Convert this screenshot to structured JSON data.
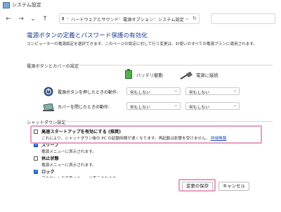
{
  "window": {
    "title": "システム設定"
  },
  "nav": {
    "breadcrumbs": [
      "ハードウェアとサウンド",
      "電源オプション",
      "システム設定"
    ]
  },
  "page": {
    "heading": "電源ボタンの定義とパスワード保護の有効化",
    "description": "コンピューターの電源設定を選択できます。このページの設定に対して行う変更は、お使いのすべての電源プランに適用されます。",
    "section_power": "電源ボタンとカバーの設定",
    "col_battery": "バッテリ駆動",
    "col_plugged": "電源に接続",
    "rows": [
      {
        "label": "電源ボタンを押したときの動作:",
        "battery": "何もしない",
        "plugged": "何もしない"
      },
      {
        "label": "カバーを閉じたときの動作:",
        "battery": "何もしない",
        "plugged": "何もしない"
      }
    ],
    "section_shutdown": "シャットダウン設定",
    "options": [
      {
        "title": "高速スタートアップを有効にする (推奨)",
        "desc": "これにより、シャットダウン後の PC の起動時間が速くなります。再起動は影響を受けません。",
        "link": "詳細情報",
        "checked": false
      },
      {
        "title": "スリープ",
        "desc": "電源メニューに表示されます。",
        "checked": true
      },
      {
        "title": "休止状態",
        "desc": "電源メニューに表示されます。",
        "checked": false
      },
      {
        "title": "ロック",
        "desc": "アカウントの画像メニューに表示されます。",
        "checked": true
      }
    ]
  },
  "footer": {
    "save": "変更の保存",
    "cancel": "キャンセル"
  },
  "colors": {
    "heading": "#1a3d8f",
    "highlight": "#e79cc4",
    "link": "#1a52c2",
    "checkbox_on": "#1f5fbf"
  }
}
